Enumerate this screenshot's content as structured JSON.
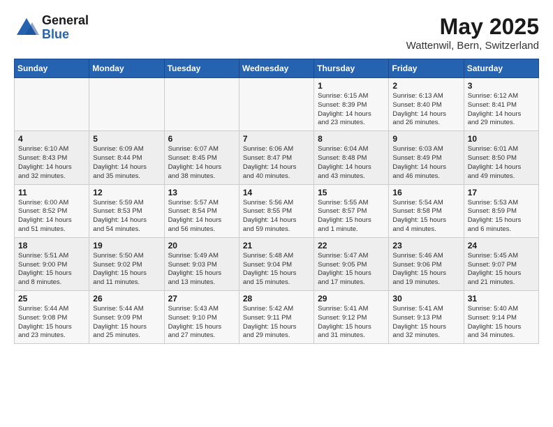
{
  "logo": {
    "general": "General",
    "blue": "Blue"
  },
  "header": {
    "title": "May 2025",
    "subtitle": "Wattenwil, Bern, Switzerland"
  },
  "weekdays": [
    "Sunday",
    "Monday",
    "Tuesday",
    "Wednesday",
    "Thursday",
    "Friday",
    "Saturday"
  ],
  "weeks": [
    [
      {
        "day": "",
        "info": ""
      },
      {
        "day": "",
        "info": ""
      },
      {
        "day": "",
        "info": ""
      },
      {
        "day": "",
        "info": ""
      },
      {
        "day": "1",
        "info": "Sunrise: 6:15 AM\nSunset: 8:39 PM\nDaylight: 14 hours\nand 23 minutes."
      },
      {
        "day": "2",
        "info": "Sunrise: 6:13 AM\nSunset: 8:40 PM\nDaylight: 14 hours\nand 26 minutes."
      },
      {
        "day": "3",
        "info": "Sunrise: 6:12 AM\nSunset: 8:41 PM\nDaylight: 14 hours\nand 29 minutes."
      }
    ],
    [
      {
        "day": "4",
        "info": "Sunrise: 6:10 AM\nSunset: 8:43 PM\nDaylight: 14 hours\nand 32 minutes."
      },
      {
        "day": "5",
        "info": "Sunrise: 6:09 AM\nSunset: 8:44 PM\nDaylight: 14 hours\nand 35 minutes."
      },
      {
        "day": "6",
        "info": "Sunrise: 6:07 AM\nSunset: 8:45 PM\nDaylight: 14 hours\nand 38 minutes."
      },
      {
        "day": "7",
        "info": "Sunrise: 6:06 AM\nSunset: 8:47 PM\nDaylight: 14 hours\nand 40 minutes."
      },
      {
        "day": "8",
        "info": "Sunrise: 6:04 AM\nSunset: 8:48 PM\nDaylight: 14 hours\nand 43 minutes."
      },
      {
        "day": "9",
        "info": "Sunrise: 6:03 AM\nSunset: 8:49 PM\nDaylight: 14 hours\nand 46 minutes."
      },
      {
        "day": "10",
        "info": "Sunrise: 6:01 AM\nSunset: 8:50 PM\nDaylight: 14 hours\nand 49 minutes."
      }
    ],
    [
      {
        "day": "11",
        "info": "Sunrise: 6:00 AM\nSunset: 8:52 PM\nDaylight: 14 hours\nand 51 minutes."
      },
      {
        "day": "12",
        "info": "Sunrise: 5:59 AM\nSunset: 8:53 PM\nDaylight: 14 hours\nand 54 minutes."
      },
      {
        "day": "13",
        "info": "Sunrise: 5:57 AM\nSunset: 8:54 PM\nDaylight: 14 hours\nand 56 minutes."
      },
      {
        "day": "14",
        "info": "Sunrise: 5:56 AM\nSunset: 8:55 PM\nDaylight: 14 hours\nand 59 minutes."
      },
      {
        "day": "15",
        "info": "Sunrise: 5:55 AM\nSunset: 8:57 PM\nDaylight: 15 hours\nand 1 minute."
      },
      {
        "day": "16",
        "info": "Sunrise: 5:54 AM\nSunset: 8:58 PM\nDaylight: 15 hours\nand 4 minutes."
      },
      {
        "day": "17",
        "info": "Sunrise: 5:53 AM\nSunset: 8:59 PM\nDaylight: 15 hours\nand 6 minutes."
      }
    ],
    [
      {
        "day": "18",
        "info": "Sunrise: 5:51 AM\nSunset: 9:00 PM\nDaylight: 15 hours\nand 8 minutes."
      },
      {
        "day": "19",
        "info": "Sunrise: 5:50 AM\nSunset: 9:02 PM\nDaylight: 15 hours\nand 11 minutes."
      },
      {
        "day": "20",
        "info": "Sunrise: 5:49 AM\nSunset: 9:03 PM\nDaylight: 15 hours\nand 13 minutes."
      },
      {
        "day": "21",
        "info": "Sunrise: 5:48 AM\nSunset: 9:04 PM\nDaylight: 15 hours\nand 15 minutes."
      },
      {
        "day": "22",
        "info": "Sunrise: 5:47 AM\nSunset: 9:05 PM\nDaylight: 15 hours\nand 17 minutes."
      },
      {
        "day": "23",
        "info": "Sunrise: 5:46 AM\nSunset: 9:06 PM\nDaylight: 15 hours\nand 19 minutes."
      },
      {
        "day": "24",
        "info": "Sunrise: 5:45 AM\nSunset: 9:07 PM\nDaylight: 15 hours\nand 21 minutes."
      }
    ],
    [
      {
        "day": "25",
        "info": "Sunrise: 5:44 AM\nSunset: 9:08 PM\nDaylight: 15 hours\nand 23 minutes."
      },
      {
        "day": "26",
        "info": "Sunrise: 5:44 AM\nSunset: 9:09 PM\nDaylight: 15 hours\nand 25 minutes."
      },
      {
        "day": "27",
        "info": "Sunrise: 5:43 AM\nSunset: 9:10 PM\nDaylight: 15 hours\nand 27 minutes."
      },
      {
        "day": "28",
        "info": "Sunrise: 5:42 AM\nSunset: 9:11 PM\nDaylight: 15 hours\nand 29 minutes."
      },
      {
        "day": "29",
        "info": "Sunrise: 5:41 AM\nSunset: 9:12 PM\nDaylight: 15 hours\nand 31 minutes."
      },
      {
        "day": "30",
        "info": "Sunrise: 5:41 AM\nSunset: 9:13 PM\nDaylight: 15 hours\nand 32 minutes."
      },
      {
        "day": "31",
        "info": "Sunrise: 5:40 AM\nSunset: 9:14 PM\nDaylight: 15 hours\nand 34 minutes."
      }
    ]
  ]
}
